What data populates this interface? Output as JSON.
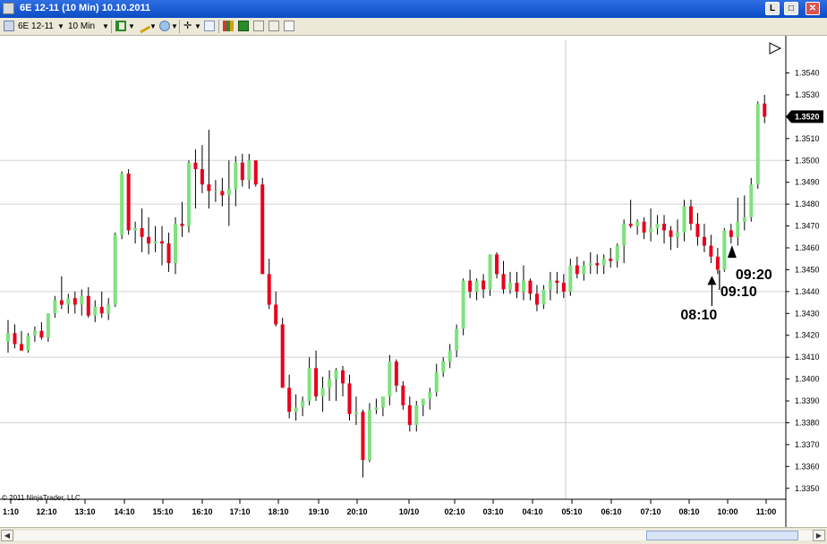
{
  "window": {
    "title": "6E 12-11 (10 Min)  10.10.2011"
  },
  "title_buttons": {
    "minimize": "L",
    "restore": "□",
    "close": "✕"
  },
  "toolbar": {
    "instrument": "6E 12-11",
    "interval": "10 Min"
  },
  "chart_data": {
    "type": "candlestick",
    "price_labels": [
      "1.3540",
      "1.3530",
      "1.3520",
      "1.3510",
      "1.3500",
      "1.3490",
      "1.3480",
      "1.3470",
      "1.3460",
      "1.3450",
      "1.3440",
      "1.3430",
      "1.3420",
      "1.3410",
      "1.3400",
      "1.3390",
      "1.3380",
      "1.3370",
      "1.3360",
      "1.3350"
    ],
    "price_values": [
      1.354,
      1.353,
      1.352,
      1.351,
      1.35,
      1.349,
      1.348,
      1.347,
      1.346,
      1.345,
      1.344,
      1.343,
      1.342,
      1.341,
      1.34,
      1.339,
      1.338,
      1.337,
      1.336,
      1.335
    ],
    "current_price": {
      "value": 1.352,
      "label": "1.3520"
    },
    "y_range": [
      1.3345,
      1.3557
    ],
    "time_labels": [
      "1:10",
      "12:10",
      "13:10",
      "14:10",
      "15:10",
      "16:10",
      "17:10",
      "18:10",
      "19:10",
      "20:10",
      "10/10",
      "02:10",
      "03:10",
      "04:10",
      "05:10",
      "06:10",
      "07:10",
      "08:10",
      "09:10",
      "10:00",
      "11:00"
    ],
    "gridlines": [
      1.35,
      1.348,
      1.344,
      1.341,
      1.338
    ],
    "candles": [
      {
        "o": 1.3417,
        "h": 1.3427,
        "l": 1.3412,
        "c": 1.3421
      },
      {
        "o": 1.3421,
        "h": 1.3425,
        "l": 1.3414,
        "c": 1.3416
      },
      {
        "o": 1.3416,
        "h": 1.3422,
        "l": 1.3413,
        "c": 1.3413
      },
      {
        "o": 1.3413,
        "h": 1.3421,
        "l": 1.3412,
        "c": 1.342
      },
      {
        "o": 1.342,
        "h": 1.3424,
        "l": 1.3417,
        "c": 1.3422
      },
      {
        "o": 1.3422,
        "h": 1.3426,
        "l": 1.3418,
        "c": 1.3419
      },
      {
        "o": 1.3419,
        "h": 1.343,
        "l": 1.3417,
        "c": 1.343
      },
      {
        "o": 1.343,
        "h": 1.3438,
        "l": 1.3428,
        "c": 1.3436
      },
      {
        "o": 1.3436,
        "h": 1.3447,
        "l": 1.3432,
        "c": 1.3434
      },
      {
        "o": 1.3434,
        "h": 1.3439,
        "l": 1.343,
        "c": 1.3437
      },
      {
        "o": 1.3437,
        "h": 1.344,
        "l": 1.343,
        "c": 1.3434
      },
      {
        "o": 1.3434,
        "h": 1.3441,
        "l": 1.3429,
        "c": 1.3438
      },
      {
        "o": 1.3438,
        "h": 1.3442,
        "l": 1.3428,
        "c": 1.3429
      },
      {
        "o": 1.3429,
        "h": 1.3436,
        "l": 1.3426,
        "c": 1.3433
      },
      {
        "o": 1.3433,
        "h": 1.344,
        "l": 1.3428,
        "c": 1.343
      },
      {
        "o": 1.343,
        "h": 1.3437,
        "l": 1.3427,
        "c": 1.3434
      },
      {
        "o": 1.3434,
        "h": 1.3467,
        "l": 1.3433,
        "c": 1.3466
      },
      {
        "o": 1.3466,
        "h": 1.3495,
        "l": 1.3464,
        "c": 1.3494
      },
      {
        "o": 1.3494,
        "h": 1.3496,
        "l": 1.3466,
        "c": 1.3468
      },
      {
        "o": 1.3468,
        "h": 1.3472,
        "l": 1.3462,
        "c": 1.3469
      },
      {
        "o": 1.3469,
        "h": 1.3478,
        "l": 1.3458,
        "c": 1.3465
      },
      {
        "o": 1.3465,
        "h": 1.3474,
        "l": 1.3457,
        "c": 1.3462
      },
      {
        "o": 1.3462,
        "h": 1.347,
        "l": 1.3458,
        "c": 1.3463
      },
      {
        "o": 1.3463,
        "h": 1.347,
        "l": 1.3452,
        "c": 1.3462
      },
      {
        "o": 1.3462,
        "h": 1.3467,
        "l": 1.3449,
        "c": 1.3453
      },
      {
        "o": 1.3453,
        "h": 1.3474,
        "l": 1.3448,
        "c": 1.3471
      },
      {
        "o": 1.3471,
        "h": 1.3481,
        "l": 1.3465,
        "c": 1.347
      },
      {
        "o": 1.347,
        "h": 1.35,
        "l": 1.3467,
        "c": 1.3499
      },
      {
        "o": 1.3499,
        "h": 1.3505,
        "l": 1.3478,
        "c": 1.3496
      },
      {
        "o": 1.3496,
        "h": 1.3507,
        "l": 1.3485,
        "c": 1.3489
      },
      {
        "o": 1.3489,
        "h": 1.3514,
        "l": 1.3478,
        "c": 1.3486
      },
      {
        "o": 1.3486,
        "h": 1.3491,
        "l": 1.3481,
        "c": 1.3486
      },
      {
        "o": 1.3486,
        "h": 1.3492,
        "l": 1.3479,
        "c": 1.3484
      },
      {
        "o": 1.3484,
        "h": 1.35,
        "l": 1.347,
        "c": 1.3487
      },
      {
        "o": 1.3487,
        "h": 1.3502,
        "l": 1.3479,
        "c": 1.3499
      },
      {
        "o": 1.3499,
        "h": 1.3503,
        "l": 1.3488,
        "c": 1.3491
      },
      {
        "o": 1.3491,
        "h": 1.3503,
        "l": 1.3487,
        "c": 1.35
      },
      {
        "o": 1.35,
        "h": 1.35,
        "l": 1.3488,
        "c": 1.3489
      },
      {
        "o": 1.3489,
        "h": 1.3492,
        "l": 1.3449,
        "c": 1.3448
      },
      {
        "o": 1.3448,
        "h": 1.3455,
        "l": 1.3432,
        "c": 1.3434
      },
      {
        "o": 1.3434,
        "h": 1.344,
        "l": 1.3424,
        "c": 1.3425
      },
      {
        "o": 1.3425,
        "h": 1.3428,
        "l": 1.3396,
        "c": 1.3396
      },
      {
        "o": 1.3396,
        "h": 1.3402,
        "l": 1.3382,
        "c": 1.3385
      },
      {
        "o": 1.3385,
        "h": 1.3393,
        "l": 1.3381,
        "c": 1.3387
      },
      {
        "o": 1.3387,
        "h": 1.3392,
        "l": 1.3383,
        "c": 1.339
      },
      {
        "o": 1.339,
        "h": 1.341,
        "l": 1.3388,
        "c": 1.3405
      },
      {
        "o": 1.3405,
        "h": 1.3413,
        "l": 1.339,
        "c": 1.3392
      },
      {
        "o": 1.3392,
        "h": 1.3401,
        "l": 1.3385,
        "c": 1.3396
      },
      {
        "o": 1.3396,
        "h": 1.3404,
        "l": 1.339,
        "c": 1.34
      },
      {
        "o": 1.34,
        "h": 1.3405,
        "l": 1.339,
        "c": 1.3404
      },
      {
        "o": 1.3404,
        "h": 1.3406,
        "l": 1.3392,
        "c": 1.3398
      },
      {
        "o": 1.3398,
        "h": 1.3402,
        "l": 1.3381,
        "c": 1.3384
      },
      {
        "o": 1.3384,
        "h": 1.3392,
        "l": 1.3379,
        "c": 1.3385
      },
      {
        "o": 1.3385,
        "h": 1.3386,
        "l": 1.3355,
        "c": 1.3363
      },
      {
        "o": 1.3363,
        "h": 1.3389,
        "l": 1.3362,
        "c": 1.3386
      },
      {
        "o": 1.3386,
        "h": 1.3391,
        "l": 1.3384,
        "c": 1.3387
      },
      {
        "o": 1.3387,
        "h": 1.3391,
        "l": 1.3383,
        "c": 1.3392
      },
      {
        "o": 1.3392,
        "h": 1.3411,
        "l": 1.3388,
        "c": 1.3408
      },
      {
        "o": 1.3408,
        "h": 1.3409,
        "l": 1.3394,
        "c": 1.3397
      },
      {
        "o": 1.3397,
        "h": 1.3399,
        "l": 1.3386,
        "c": 1.3388
      },
      {
        "o": 1.3388,
        "h": 1.3392,
        "l": 1.3376,
        "c": 1.3379
      },
      {
        "o": 1.3379,
        "h": 1.339,
        "l": 1.3376,
        "c": 1.3388
      },
      {
        "o": 1.3388,
        "h": 1.3391,
        "l": 1.3383,
        "c": 1.3391
      },
      {
        "o": 1.3391,
        "h": 1.3396,
        "l": 1.3386,
        "c": 1.3394
      },
      {
        "o": 1.3394,
        "h": 1.3407,
        "l": 1.3392,
        "c": 1.3403
      },
      {
        "o": 1.3403,
        "h": 1.341,
        "l": 1.3401,
        "c": 1.3408
      },
      {
        "o": 1.3408,
        "h": 1.3416,
        "l": 1.3405,
        "c": 1.3413
      },
      {
        "o": 1.3413,
        "h": 1.3425,
        "l": 1.341,
        "c": 1.3423
      },
      {
        "o": 1.3423,
        "h": 1.3446,
        "l": 1.342,
        "c": 1.3445
      },
      {
        "o": 1.3445,
        "h": 1.345,
        "l": 1.3437,
        "c": 1.344
      },
      {
        "o": 1.344,
        "h": 1.3446,
        "l": 1.3436,
        "c": 1.3445
      },
      {
        "o": 1.3445,
        "h": 1.3448,
        "l": 1.3437,
        "c": 1.3441
      },
      {
        "o": 1.3441,
        "h": 1.3457,
        "l": 1.3438,
        "c": 1.3457
      },
      {
        "o": 1.3457,
        "h": 1.3458,
        "l": 1.3446,
        "c": 1.3448
      },
      {
        "o": 1.3448,
        "h": 1.3454,
        "l": 1.3439,
        "c": 1.3441
      },
      {
        "o": 1.3441,
        "h": 1.3449,
        "l": 1.3439,
        "c": 1.3444
      },
      {
        "o": 1.3444,
        "h": 1.3449,
        "l": 1.3437,
        "c": 1.344
      },
      {
        "o": 1.344,
        "h": 1.3452,
        "l": 1.3436,
        "c": 1.3445
      },
      {
        "o": 1.3445,
        "h": 1.3446,
        "l": 1.3436,
        "c": 1.3439
      },
      {
        "o": 1.3439,
        "h": 1.3443,
        "l": 1.3431,
        "c": 1.3434
      },
      {
        "o": 1.3434,
        "h": 1.3443,
        "l": 1.3432,
        "c": 1.3441
      },
      {
        "o": 1.3441,
        "h": 1.3449,
        "l": 1.3436,
        "c": 1.3445
      },
      {
        "o": 1.3445,
        "h": 1.3449,
        "l": 1.3439,
        "c": 1.3444
      },
      {
        "o": 1.3444,
        "h": 1.3448,
        "l": 1.3437,
        "c": 1.344
      },
      {
        "o": 1.344,
        "h": 1.3455,
        "l": 1.3438,
        "c": 1.3452
      },
      {
        "o": 1.3452,
        "h": 1.3456,
        "l": 1.3446,
        "c": 1.3448
      },
      {
        "o": 1.3448,
        "h": 1.3454,
        "l": 1.3445,
        "c": 1.3452
      },
      {
        "o": 1.3452,
        "h": 1.3458,
        "l": 1.3448,
        "c": 1.3453
      },
      {
        "o": 1.3453,
        "h": 1.3457,
        "l": 1.3448,
        "c": 1.3452
      },
      {
        "o": 1.3452,
        "h": 1.3457,
        "l": 1.3448,
        "c": 1.3455
      },
      {
        "o": 1.3455,
        "h": 1.346,
        "l": 1.3451,
        "c": 1.3454
      },
      {
        "o": 1.3454,
        "h": 1.3462,
        "l": 1.3451,
        "c": 1.3461
      },
      {
        "o": 1.3461,
        "h": 1.3473,
        "l": 1.3453,
        "c": 1.3471
      },
      {
        "o": 1.3471,
        "h": 1.3482,
        "l": 1.3469,
        "c": 1.347
      },
      {
        "o": 1.347,
        "h": 1.3473,
        "l": 1.3466,
        "c": 1.3472
      },
      {
        "o": 1.3472,
        "h": 1.3474,
        "l": 1.3464,
        "c": 1.3467
      },
      {
        "o": 1.3467,
        "h": 1.3478,
        "l": 1.3463,
        "c": 1.3469
      },
      {
        "o": 1.3469,
        "h": 1.3475,
        "l": 1.3466,
        "c": 1.3471
      },
      {
        "o": 1.3471,
        "h": 1.3475,
        "l": 1.3462,
        "c": 1.3468
      },
      {
        "o": 1.3468,
        "h": 1.347,
        "l": 1.3459,
        "c": 1.3465
      },
      {
        "o": 1.3465,
        "h": 1.3473,
        "l": 1.346,
        "c": 1.3467
      },
      {
        "o": 1.3467,
        "h": 1.3482,
        "l": 1.3463,
        "c": 1.3479
      },
      {
        "o": 1.3479,
        "h": 1.3482,
        "l": 1.3468,
        "c": 1.3471
      },
      {
        "o": 1.3471,
        "h": 1.3476,
        "l": 1.3461,
        "c": 1.3465
      },
      {
        "o": 1.3465,
        "h": 1.3471,
        "l": 1.3458,
        "c": 1.3461
      },
      {
        "o": 1.3461,
        "h": 1.3466,
        "l": 1.3453,
        "c": 1.3456
      },
      {
        "o": 1.3456,
        "h": 1.346,
        "l": 1.3448,
        "c": 1.345
      },
      {
        "o": 1.345,
        "h": 1.3469,
        "l": 1.3449,
        "c": 1.3468
      },
      {
        "o": 1.3468,
        "h": 1.3471,
        "l": 1.3462,
        "c": 1.3465
      },
      {
        "o": 1.3465,
        "h": 1.3483,
        "l": 1.3461,
        "c": 1.3472
      },
      {
        "o": 1.3472,
        "h": 1.3484,
        "l": 1.3468,
        "c": 1.3474
      },
      {
        "o": 1.3474,
        "h": 1.3492,
        "l": 1.3472,
        "c": 1.3489
      },
      {
        "o": 1.3489,
        "h": 1.3527,
        "l": 1.3487,
        "c": 1.3526
      },
      {
        "o": 1.3526,
        "h": 1.353,
        "l": 1.3517,
        "c": 1.352
      }
    ],
    "annotations": [
      {
        "label": "08:10",
        "candle": 105,
        "price": 1.3448
      },
      {
        "label": "09:10",
        "candle": 106
      },
      {
        "label": "09:20",
        "candle": 108,
        "price": 1.3462
      }
    ],
    "copyright": "© 2011 NinjaTrader, LLC",
    "colors": {
      "up": "#7ee27e",
      "down": "#e8001c",
      "axis_marker": "#000000"
    }
  }
}
